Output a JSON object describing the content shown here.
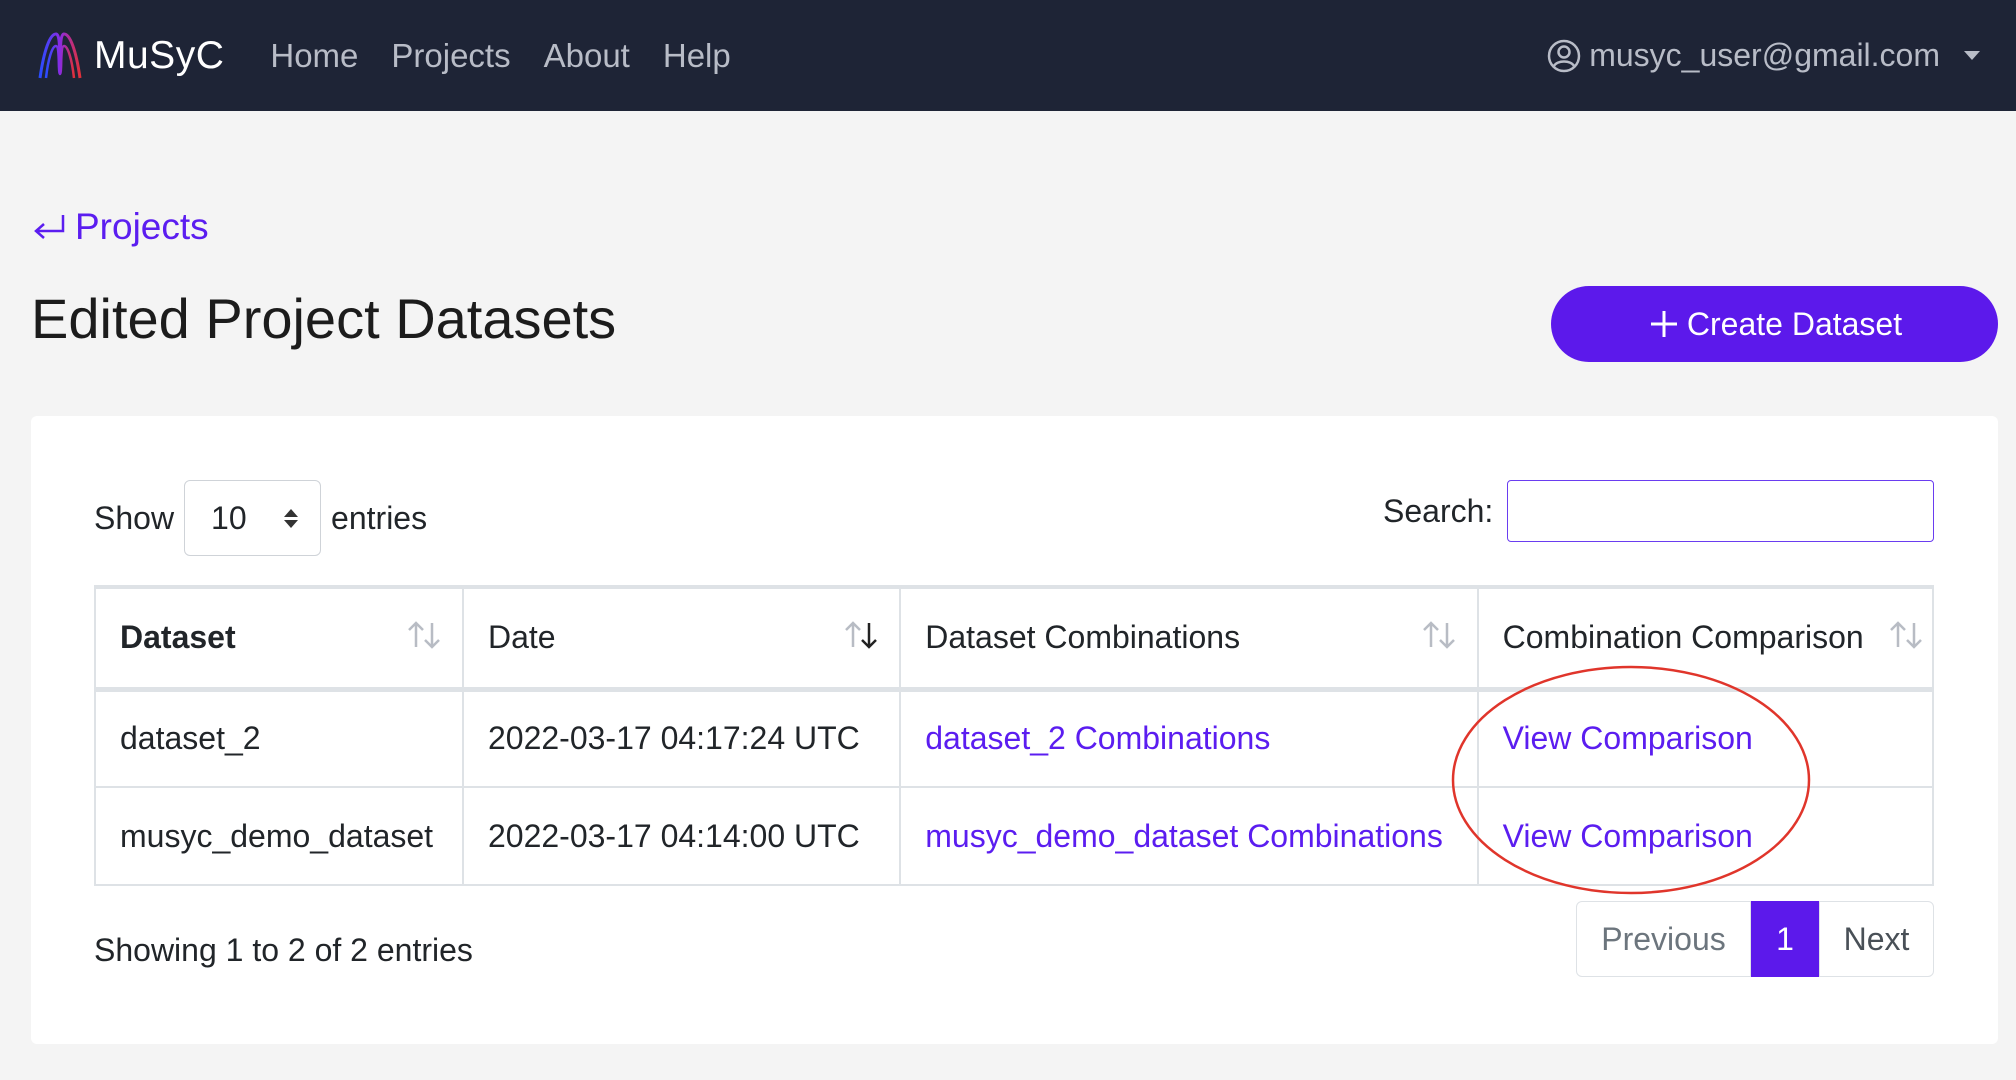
{
  "navbar": {
    "brand": "MuSyC",
    "links": [
      "Home",
      "Projects",
      "About",
      "Help"
    ],
    "user_email": "musyc_user@gmail.com"
  },
  "back_link": "Projects",
  "page_title": "Edited Project Datasets",
  "create_button": "Create Dataset",
  "length_control": {
    "show_label": "Show",
    "selected": "10",
    "entries_label": "entries"
  },
  "search": {
    "label": "Search:",
    "value": ""
  },
  "table": {
    "headers": [
      "Dataset",
      "Date",
      "Dataset Combinations",
      "Combination Comparison"
    ],
    "rows": [
      {
        "dataset": "dataset_2",
        "date": "2022-03-17 04:17:24 UTC",
        "combinations": "dataset_2 Combinations",
        "comparison": "View Comparison"
      },
      {
        "dataset": "musyc_demo_dataset",
        "date": "2022-03-17 04:14:00 UTC",
        "combinations": "musyc_demo_dataset Combinations",
        "comparison": "View Comparison"
      }
    ]
  },
  "info": "Showing 1 to 2 of 2 entries",
  "pagination": {
    "previous": "Previous",
    "current": "1",
    "next": "Next"
  },
  "colors": {
    "navbar_bg": "#1e2436",
    "accent": "#5c19eb",
    "link": "#5b1df0",
    "annotation": "#e0352b"
  },
  "icons": {
    "logo": "musyc-logo-icon",
    "user": "user-circle-icon",
    "back": "return-arrow-icon",
    "plus": "plus-icon",
    "sort": "sort-arrows-icon"
  }
}
